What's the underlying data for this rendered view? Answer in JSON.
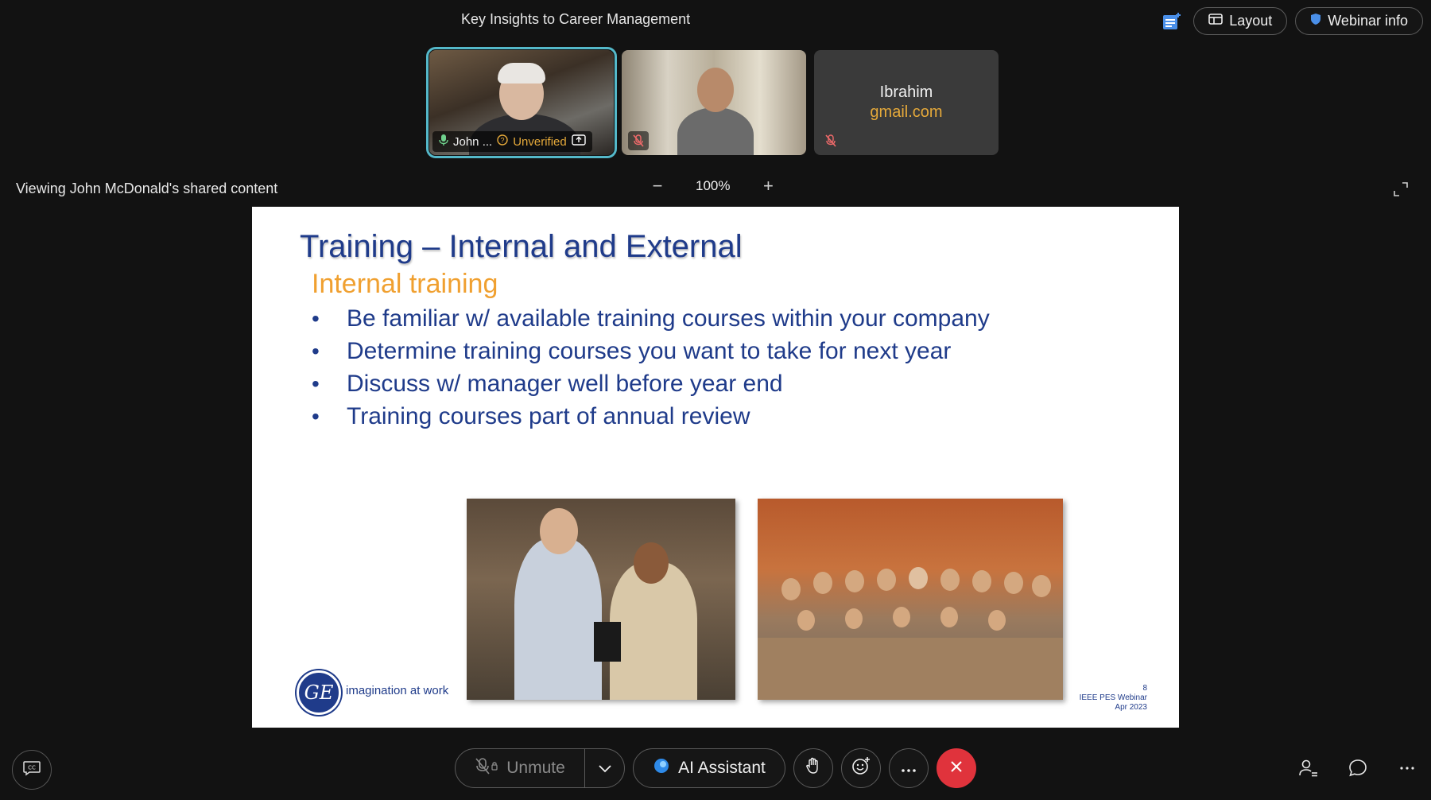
{
  "window": {
    "title": "Key Insights to Career Management"
  },
  "header": {
    "layout_label": "Layout",
    "webinar_info_label": "Webinar info"
  },
  "participants": [
    {
      "name": "John ...",
      "status": "Unverified",
      "active": true
    },
    {
      "name": "",
      "muted": true
    },
    {
      "name": "Ibrahim",
      "email": "gmail.com",
      "muted": true
    }
  ],
  "share": {
    "viewing_text": "Viewing John McDonald's shared content",
    "zoom": "100%"
  },
  "slide": {
    "title": "Training – Internal and External",
    "subtitle": "Internal training",
    "bullets": [
      "Be familiar w/ available training courses within your company",
      "Determine training courses you want to take for next year",
      "Discuss w/ manager well before year end",
      "Training courses part of annual review"
    ],
    "logo_text": "GE",
    "tagline": "imagination at work",
    "footer": {
      "page": "8",
      "event": "IEEE PES Webinar",
      "date": "Apr 2023"
    }
  },
  "controls": {
    "unmute_label": "Unmute",
    "ai_label": "AI Assistant"
  },
  "colors": {
    "accent_teal": "#54b8c9",
    "end_red": "#e0333c",
    "slide_blue": "#1f3b8a",
    "slide_orange": "#f0a030",
    "warning": "#e5a93a"
  }
}
